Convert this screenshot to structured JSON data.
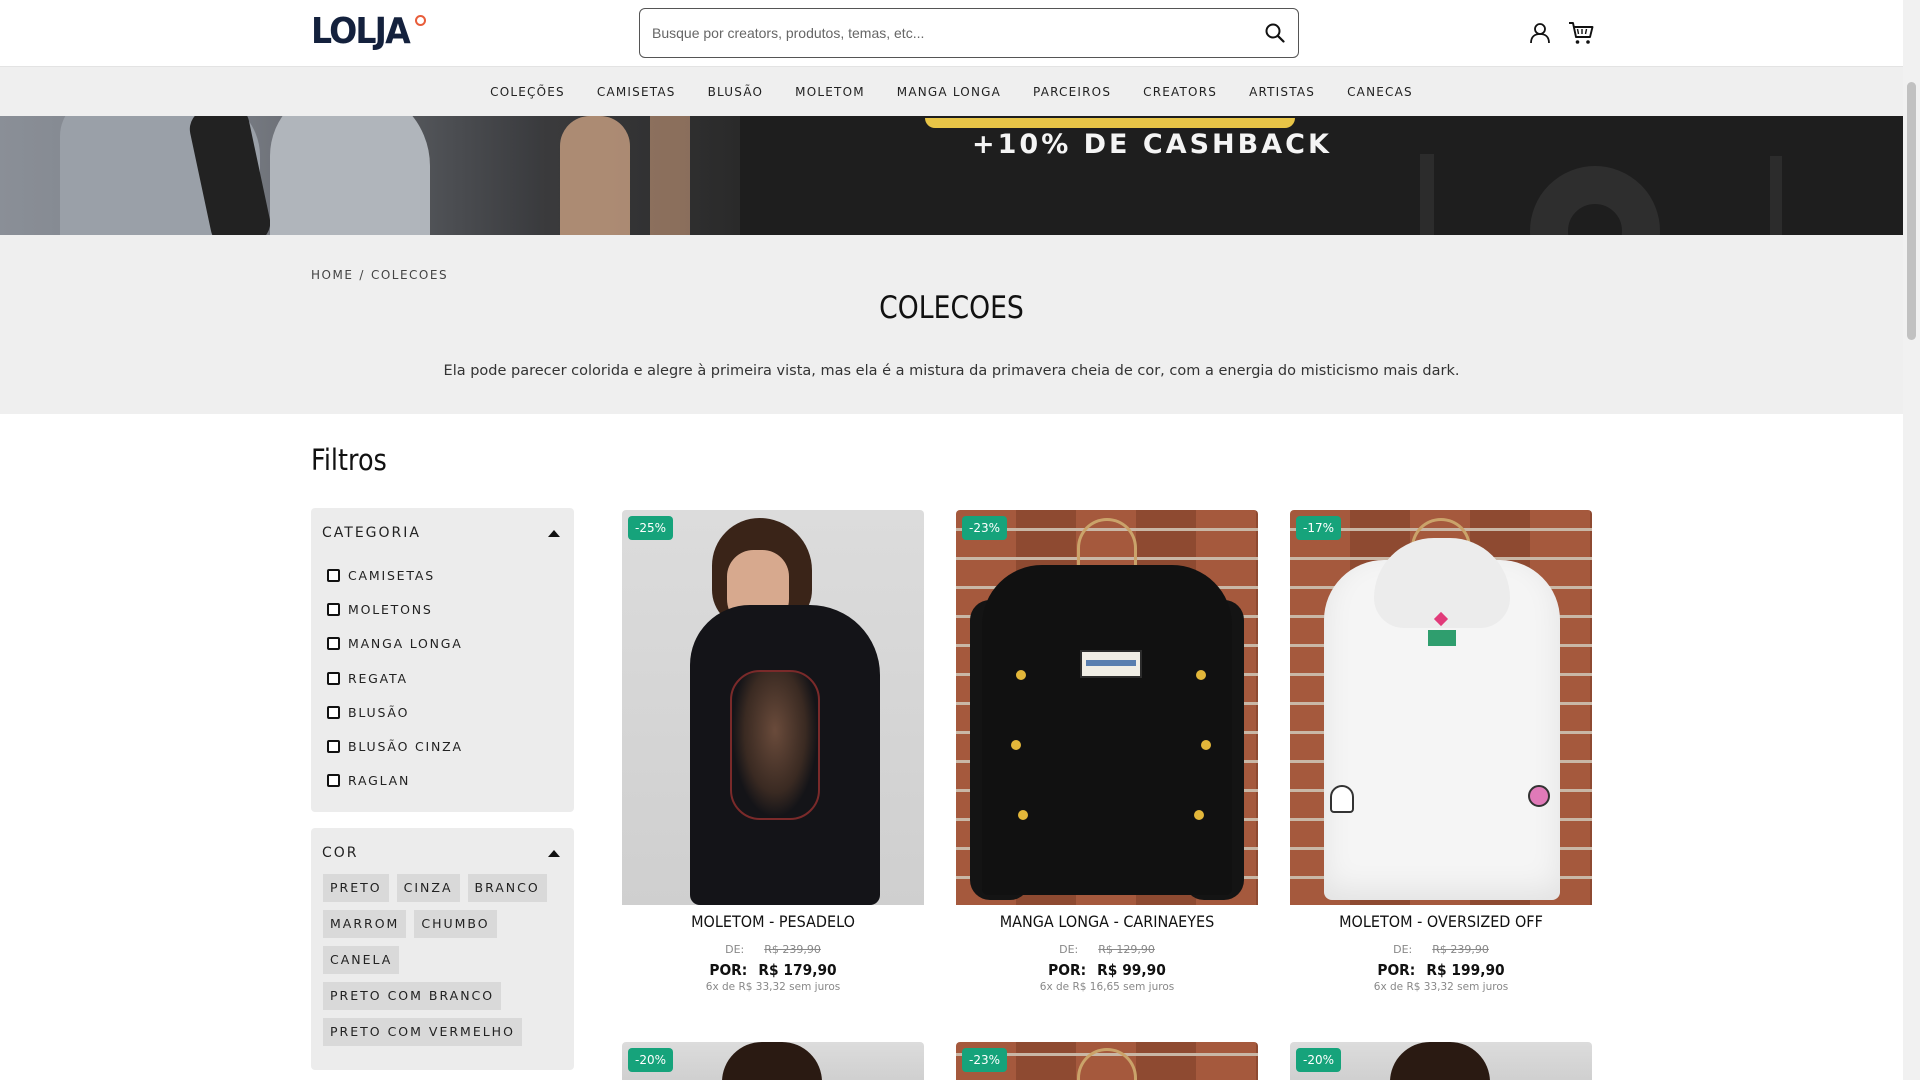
{
  "header": {
    "logo": "LOLJA",
    "search_placeholder": "Busque por creators, produtos, temas, etc...",
    "search_value": ""
  },
  "nav": [
    "COLEÇÕES",
    "CAMISETAS",
    "BLUSÃO",
    "MOLETOM",
    "MANGA LONGA",
    "PARCEIROS",
    "CREATORS",
    "ARTISTAS",
    "CANECAS"
  ],
  "banner": {
    "text": "+10% DE CASHBACK"
  },
  "breadcrumb": {
    "home": "HOME",
    "sep": "/",
    "current": "COLECOES"
  },
  "page": {
    "title": "COLECOES",
    "description": "Ela pode parecer colorida e alegre à primeira vista, mas ela é a mistura da primavera cheia de cor, com a energia do misticismo mais dark."
  },
  "filters": {
    "title": "Filtros",
    "categoria": {
      "label": "CATEGORIA",
      "items": [
        "CAMISETAS",
        "MOLETONS",
        "MANGA LONGA",
        "REGATA",
        "BLUSÃO",
        "BLUSÃO CINZA",
        "RAGLAN"
      ]
    },
    "cor": {
      "label": "COR",
      "items": [
        "PRETO",
        "CINZA",
        "BRANCO",
        "MARROM",
        "CHUMBO",
        "CANELA",
        "PRETO COM BRANCO",
        "PRETO COM VERMELHO"
      ]
    }
  },
  "products": [
    {
      "badge": "-25%",
      "name": "MOLETOM - PESADELO",
      "de_label": "DE:",
      "old_price": "R$ 239,90",
      "por_label": "POR:",
      "price": "R$ 179,90",
      "installments": "6x de R$ 33,32 sem juros"
    },
    {
      "badge": "-23%",
      "name": "MANGA LONGA - CARINAEYES",
      "de_label": "DE:",
      "old_price": "R$ 129,90",
      "por_label": "POR:",
      "price": "R$ 99,90",
      "installments": "6x de R$ 16,65 sem juros"
    },
    {
      "badge": "-17%",
      "name": "MOLETOM - OVERSIZED OFF",
      "de_label": "DE:",
      "old_price": "R$ 239,90",
      "por_label": "POR:",
      "price": "R$ 199,90",
      "installments": "6x de R$ 33,32 sem juros"
    }
  ],
  "next_row_badges": [
    "-20%",
    "-23%",
    "-20%"
  ],
  "colors": {
    "accent_green": "#16a37b",
    "logo_navy": "#14213d",
    "logo_dot": "#e85d3a",
    "banner_yellow": "#e8c547"
  }
}
